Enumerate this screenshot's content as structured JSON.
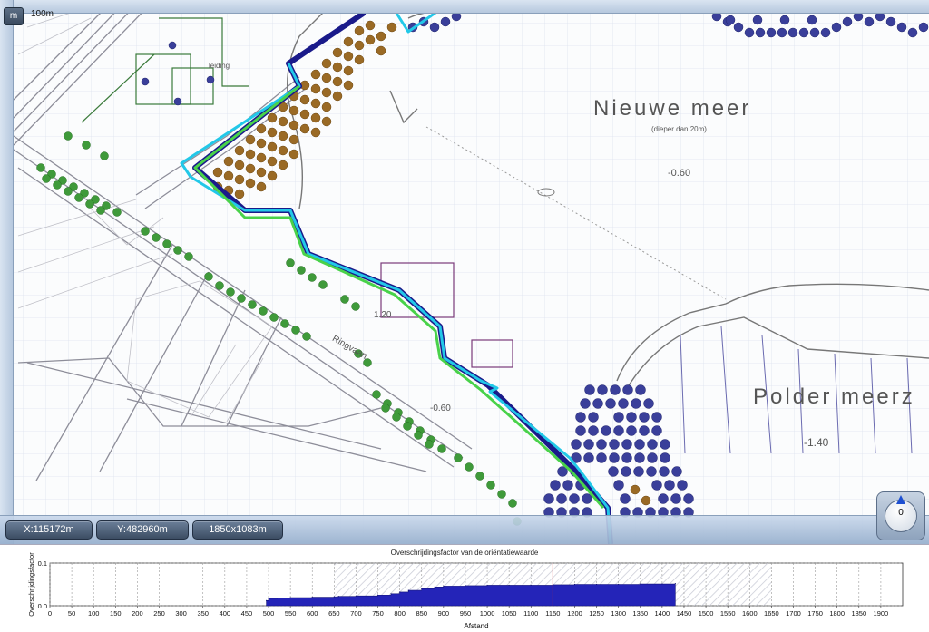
{
  "toolbar": {
    "unit_button": "m",
    "scale": "100m"
  },
  "map": {
    "labels": {
      "lake": "Nieuwe meer",
      "lake_depth": "(dieper dan 20m)",
      "depth_1": "-0.60",
      "polder": "Polder meerz",
      "depth_2": "-1.40",
      "canal": "Ringvaart",
      "depth_3": "-0.60",
      "level_1": "1.20",
      "pipeline": "leiding"
    }
  },
  "status": {
    "x": "X:115172m",
    "y": "Y:482960m",
    "extent": "1850x1083m"
  },
  "compass": {
    "value": "0"
  },
  "colors": {
    "route_cyan": "#22c8e8",
    "route_green": "#49d24a",
    "route_blue": "#1a1a8a",
    "tree_brown": "#9a6a25",
    "tree_green": "#3f9a3a",
    "tree_blue": "#3a3f9a"
  },
  "chart_data": {
    "type": "area",
    "title": "Overschrijdingsfactor van de oriëntatiewaarde",
    "xlabel": "Afstand",
    "ylabel": "Overschrijdingsfactor",
    "xlim": [
      0,
      1950
    ],
    "ylim": [
      0,
      0.1
    ],
    "y_ticks": [
      "0.0",
      "0.1"
    ],
    "x_ticks": [
      0,
      50,
      100,
      150,
      200,
      250,
      300,
      350,
      400,
      450,
      500,
      550,
      600,
      650,
      700,
      750,
      800,
      850,
      900,
      950,
      1000,
      1050,
      1100,
      1150,
      1200,
      1250,
      1300,
      1350,
      1400,
      1450,
      1500,
      1550,
      1600,
      1650,
      1700,
      1750,
      1800,
      1850,
      1900
    ],
    "highlight_range": [
      650,
      1650
    ],
    "marker_x": 1150,
    "grid": true,
    "legend": "none",
    "x": [
      495,
      500,
      520,
      550,
      600,
      650,
      660,
      700,
      750,
      780,
      800,
      820,
      850,
      880,
      900,
      950,
      1000,
      1050,
      1100,
      1150,
      1200,
      1250,
      1300,
      1350,
      1400,
      1430
    ],
    "y": [
      0.012,
      0.017,
      0.018,
      0.019,
      0.02,
      0.021,
      0.022,
      0.023,
      0.025,
      0.028,
      0.032,
      0.036,
      0.04,
      0.044,
      0.046,
      0.047,
      0.048,
      0.048,
      0.048,
      0.049,
      0.05,
      0.05,
      0.05,
      0.051,
      0.051,
      0.052
    ]
  }
}
